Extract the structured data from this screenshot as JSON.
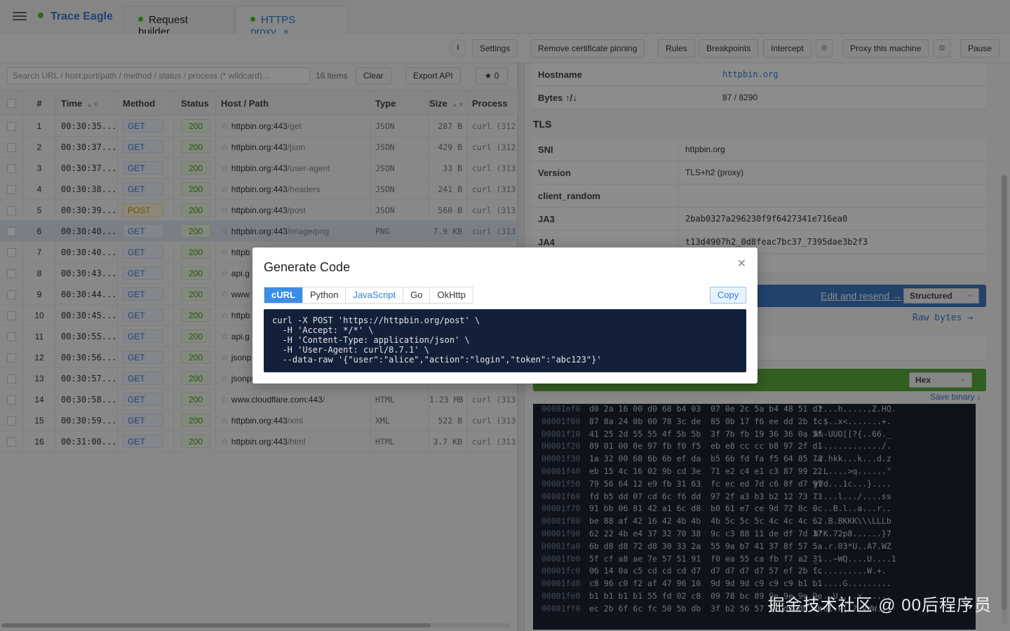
{
  "app": {
    "title": "Trace Eagle"
  },
  "tabs": [
    {
      "label": "Request builder",
      "closable": false
    },
    {
      "label": "HTTPS proxy",
      "closable": true
    }
  ],
  "toolbar": {
    "info": "i",
    "settings": "Settings",
    "remove_pinning": "Remove certificate pinning",
    "rules": "Rules",
    "breakpoints": "Breakpoints",
    "intercept": "Intercept",
    "proxy_machine": "Proxy this machine",
    "pause": "Pause"
  },
  "filter": {
    "search_placeholder": "Search URL / host:port/path / method / status / process (* wildcard)...",
    "count": "16 items",
    "clear": "Clear",
    "export": "Export API",
    "star_count": "★ 0"
  },
  "table": {
    "columns": {
      "num": "#",
      "time": "Time",
      "method": "Method",
      "status": "Status",
      "host": "Host / Path",
      "type": "Type",
      "size": "Size",
      "process": "Process"
    },
    "rows": [
      {
        "num": "1",
        "time": "00:30:35...",
        "method": "GET",
        "status": "200",
        "host": "httpbin.org:443",
        "path": "/get",
        "type": "JSON",
        "size": "287 B",
        "process": "curl (312"
      },
      {
        "num": "2",
        "time": "00:30:37...",
        "method": "GET",
        "status": "200",
        "host": "httpbin.org:443",
        "path": "/json",
        "type": "JSON",
        "size": "429 B",
        "process": "curl (312"
      },
      {
        "num": "3",
        "time": "00:30:37...",
        "method": "GET",
        "status": "200",
        "host": "httpbin.org:443",
        "path": "/user-agent",
        "type": "JSON",
        "size": "33 B",
        "process": "curl (313"
      },
      {
        "num": "4",
        "time": "00:30:38...",
        "method": "GET",
        "status": "200",
        "host": "httpbin.org:443",
        "path": "/headers",
        "type": "JSON",
        "size": "241 B",
        "process": "curl (313"
      },
      {
        "num": "5",
        "time": "00:30:39...",
        "method": "POST",
        "status": "200",
        "host": "httpbin.org:443",
        "path": "/post",
        "type": "JSON",
        "size": "560 B",
        "process": "curl (313"
      },
      {
        "num": "6",
        "time": "00:30:40...",
        "method": "GET",
        "status": "200",
        "host": "httpbin.org:443",
        "path": "/image/png",
        "type": "PNG",
        "size": "7.9 KB",
        "process": "curl (313"
      },
      {
        "num": "7",
        "time": "00:30:40...",
        "method": "GET",
        "status": "200",
        "host": "httpb",
        "path": "",
        "type": "",
        "size": "",
        "process": ""
      },
      {
        "num": "8",
        "time": "00:30:43...",
        "method": "GET",
        "status": "200",
        "host": "api.g",
        "path": "",
        "type": "",
        "size": "",
        "process": ""
      },
      {
        "num": "9",
        "time": "00:30:44...",
        "method": "GET",
        "status": "200",
        "host": "www",
        "path": "",
        "type": "",
        "size": "",
        "process": ""
      },
      {
        "num": "10",
        "time": "00:30:45...",
        "method": "GET",
        "status": "200",
        "host": "httpb",
        "path": "",
        "type": "",
        "size": "",
        "process": ""
      },
      {
        "num": "11",
        "time": "00:30:55...",
        "method": "GET",
        "status": "200",
        "host": "api.g",
        "path": "",
        "type": "",
        "size": "",
        "process": ""
      },
      {
        "num": "12",
        "time": "00:30:56...",
        "method": "GET",
        "status": "200",
        "host": "jsonp",
        "path": "",
        "type": "",
        "size": "",
        "process": ""
      },
      {
        "num": "13",
        "time": "00:30:57...",
        "method": "GET",
        "status": "200",
        "host": "jsonplaceholder.typicode.com",
        "path": "",
        "type": "JSON",
        "size": "",
        "process": ""
      },
      {
        "num": "14",
        "time": "00:30:58...",
        "method": "GET",
        "status": "200",
        "host": "www.cloudflare.com:443",
        "path": "/",
        "type": "HTML",
        "size": "1.23 MB",
        "process": "curl (313"
      },
      {
        "num": "15",
        "time": "00:30:59...",
        "method": "GET",
        "status": "200",
        "host": "httpbin.org:443",
        "path": "/xml",
        "type": "XML",
        "size": "522 B",
        "process": "curl (313"
      },
      {
        "num": "16",
        "time": "00:31:00...",
        "method": "GET",
        "status": "200",
        "host": "httpbin.org:443",
        "path": "/html",
        "type": "HTML",
        "size": "3.7 KB",
        "process": "curl (313"
      }
    ]
  },
  "details": {
    "hostname_label": "Hostname",
    "hostname": "httpbin.org",
    "bytes_label": "Bytes ↑/↓",
    "bytes": "87 / 8290",
    "tls_title": "TLS",
    "sni_label": "SNI",
    "sni": "httpbin.org",
    "version_label": "Version",
    "version": "TLS+h2 (proxy)",
    "client_random_label": "client_random",
    "client_random": "",
    "ja3_label": "JA3",
    "ja3": "2bab0327a296230f9f6427341e716ea0",
    "ja4_label": "JA4",
    "ja4": "t13d4907h2_0d8feac7bc37_7395dae3b2f3",
    "edit_resend": "Edit and resend →",
    "view_mode": "Structured",
    "raw_bytes": "Raw bytes →",
    "hex_mode": "Hex",
    "save_binary": "Save binary ↓"
  },
  "hexdump": [
    {
      "off": "00001ef0",
      "bytes": "d0 2a 16 00 d0 68 b4 03  07 0e 2c 5a b4 48 51 d1",
      "asc": ".*...h.....,Z.HQ."
    },
    {
      "off": "00001f00",
      "bytes": "87 8a 24 0b 00 78 3c de  85 0b 17 f6 ee dd 2b fc",
      "asc": "..$..x<.......+."
    },
    {
      "off": "00001f10",
      "bytes": "41 25 2d 55 55 4f 5b 5b  3f 7b fb 19 36 36 0a 5f",
      "asc": "A%-UUO[[?{..66._"
    },
    {
      "off": "00001f20",
      "bytes": "89 01 00 0e 97 fb f0 f5  eb e8 cc cc b8 97 2f d1",
      "asc": "............../."
    },
    {
      "off": "00001f30",
      "bytes": "1a 32 00 68 6b 6b ef da  b5 6b fd fa f5 64 85 7a",
      "asc": ".2.hkk...k...d.z"
    },
    {
      "off": "00001f40",
      "bytes": "eb 15 4c 16 02 9b cd 3e  71 e2 c4 e1 c3 87 99 22",
      "asc": "..L....>q......\""
    },
    {
      "off": "00001f50",
      "bytes": "79 56 64 12 e9 fb 31 63  fc ec ed 7d c6 8f d7 97",
      "asc": "yVd...1c...}...."
    },
    {
      "off": "00001f60",
      "bytes": "fd b5 dd 07 cd 6c f6 dd  97 2f a3 b3 b2 12 73 73",
      "asc": ".....l.../....ss"
    },
    {
      "off": "00001f70",
      "bytes": "91 bb 06 81 42 a1 6c d8  b0 61 e7 ce 9d 72 8c 0c",
      "asc": "....B.l..a...r.."
    },
    {
      "off": "00001f80",
      "bytes": "be 88 af 42 16 42 4b 4b  4b 5c 5c 5c 4c 4c 4c 62",
      "asc": "...B.BKKK\\\\\\LLLb"
    },
    {
      "off": "00001f90",
      "bytes": "62 22 4b e4 37 32 70 38  9c c3 88 11 de df 7d 37",
      "asc": "b\"K.72p8......}7"
    },
    {
      "off": "00001fa0",
      "bytes": "6b d8 d8 72 d8 30 33 2a  55 9a b7 41 37 8f 57 5a",
      "asc": "...r.03*U..A7.WZ"
    },
    {
      "off": "00001fb0",
      "bytes": "5f cf a8 ae 7e 57 51 91  f0 ea 55 ca fb f7 a2 31",
      "asc": "_...~WQ....U....1"
    },
    {
      "off": "00001fc0",
      "bytes": "06 14 0a c5 cd cd cd d7  d7 d7 d7 d7 57 ef 2b fc",
      "asc": "...........W.+."
    },
    {
      "off": "00001fd0",
      "bytes": "c8 96 c0 f2 af 47 96 10  9d 9d 9d c9 c9 c9 b1 b1",
      "asc": "......G........."
    },
    {
      "off": "00001fe0",
      "bytes": "b1 b1 b1 b1 55 fd 02 c8  09 78 bc 89 9e 9e 9e 9e",
      "asc": "....U....x......"
    },
    {
      "off": "00001ff0",
      "bytes": "ec 2b 6f 6c fc 50 5b db  3f b2 56 57 57 d7 db db",
      "asc": ".+ol.P[.?.VWW..."
    }
  ],
  "modal": {
    "title": "Generate Code",
    "close": "✕",
    "langs": [
      "cURL",
      "Python",
      "JavaScript",
      "Go",
      "OkHttp"
    ],
    "copy": "Copy",
    "code": "curl -X POST 'https://httpbin.org/post' \\\n  -H 'Accept: */*' \\\n  -H 'Content-Type: application/json' \\\n  -H 'User-Agent: curl/8.7.1' \\\n  --data-raw '{\"user\":\"alice\",\"action\":\"login\",\"token\":\"abc123\"}'"
  },
  "watermark": "掘金技术社区 @ 00后程序员",
  "colors": {
    "accent": "#3a8ee6",
    "brand": "#3a7bd5",
    "status_ok": "#52c41a",
    "edit_bar": "#3b78c4",
    "hex_bar": "#5bac3a",
    "code_bg": "#12203a"
  }
}
